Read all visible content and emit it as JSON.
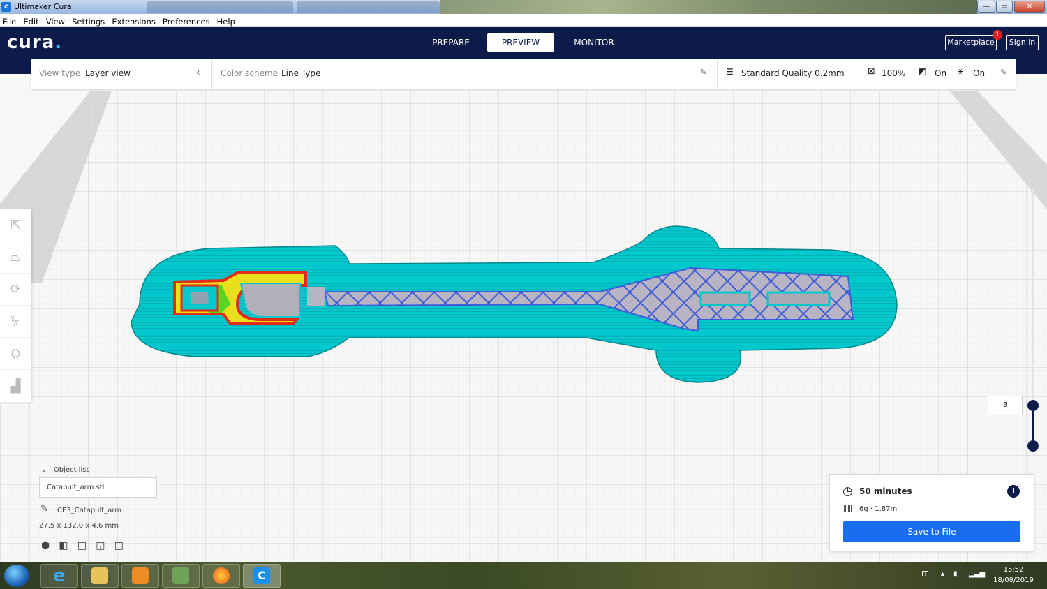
{
  "window": {
    "title": "Ultimaker Cura",
    "app_icon_letter": "c"
  },
  "menu": [
    "File",
    "Edit",
    "View",
    "Settings",
    "Extensions",
    "Preferences",
    "Help"
  ],
  "header": {
    "logo_text": "cura",
    "tabs": [
      {
        "label": "PREPARE",
        "active": false
      },
      {
        "label": "PREVIEW",
        "active": true
      },
      {
        "label": "MONITOR",
        "active": false
      }
    ],
    "marketplace_label": "Marketplace",
    "marketplace_badge": "1",
    "signin_label": "Sign in"
  },
  "settings_bar": {
    "view_type_label": "View type",
    "view_type_value": "Layer view",
    "color_scheme_label": "Color scheme",
    "color_scheme_value": "Line Type",
    "quality": "Standard Quality 0.2mm",
    "infill": "100%",
    "support": "On",
    "adhesion": "On"
  },
  "object_list": {
    "header": "Object list",
    "file": "Catapult_arm.stl",
    "job_name": "CE3_Catapult_arm",
    "dimensions": "27.5 x 132.0 x 4.6 mm"
  },
  "layer_slider": {
    "current_layer": "3"
  },
  "print_info": {
    "time": "50 minutes",
    "material": "6g · 1.87m",
    "save_label": "Save to File"
  },
  "taskbar": {
    "language": "IT",
    "time": "15:52",
    "date": "18/09/2019"
  },
  "colors": {
    "header_bg": "#0d1b4b",
    "accent_blue": "#196ef0",
    "skirt_cyan": "#00c8cc",
    "infill_blue": "#3f5bd8",
    "wall_red": "#e52a16",
    "wall_yellow": "#e8e01c",
    "wall_green": "#57d61f"
  },
  "icons": [
    "menu-icon",
    "chevron-left-icon",
    "pencil-icon",
    "quality-icon",
    "infill-icon",
    "support-icon",
    "adhesion-icon",
    "clock-icon",
    "material-icon",
    "info-icon"
  ]
}
